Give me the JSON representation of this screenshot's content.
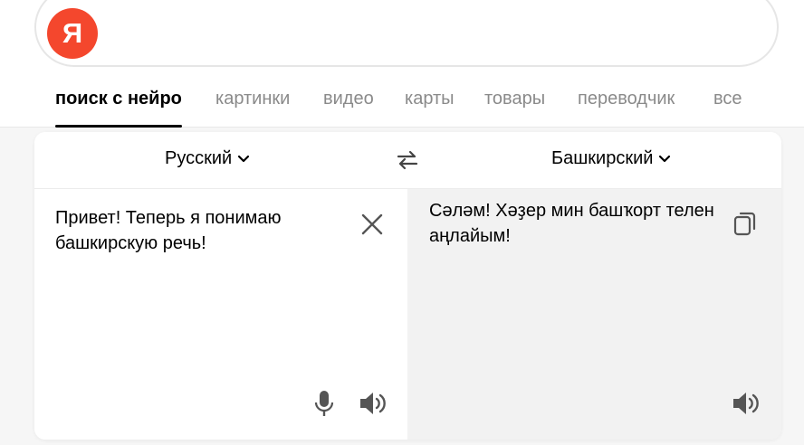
{
  "search": {
    "logo_letter": "Я",
    "query": ""
  },
  "nav": {
    "tabs": [
      {
        "label": "поиск с нейро",
        "active": true
      },
      {
        "label": "картинки"
      },
      {
        "label": "видео"
      },
      {
        "label": "карты"
      },
      {
        "label": "товары"
      },
      {
        "label": "переводчик"
      },
      {
        "label": "все"
      }
    ]
  },
  "translator": {
    "source_lang": "Русский",
    "target_lang": "Башкирский",
    "source_text": "Привет! Теперь я понимаю башкирскую речь!",
    "target_text": "Сәләм! Хәҙер мин башҡорт телен аңлайым!"
  },
  "colors": {
    "brand": "#f4472d",
    "target_pane": "#f2f2f2",
    "icon": "#555555"
  },
  "icons": [
    "chevron-down-icon",
    "swap-icon",
    "close-icon",
    "microphone-icon",
    "speaker-icon",
    "copy-icon"
  ]
}
